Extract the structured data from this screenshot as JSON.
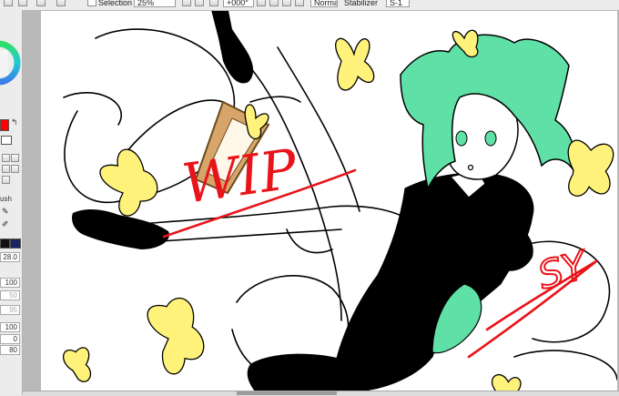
{
  "toolbar": {
    "selection_label": "Selection",
    "zoom_value": "25%",
    "rotation_value": "+000°",
    "blend_mode_value": "Normal",
    "stabilizer_label": "Stabilizer",
    "stabilizer_value": "S-1"
  },
  "left_panel": {
    "brush_label": "ush",
    "brush_size_value": "28.0",
    "rows": [
      "100",
      "50",
      "95",
      "100",
      "0",
      "80"
    ]
  },
  "canvas": {
    "wip_text": "WIP",
    "signature_text": "SY",
    "colors": {
      "hair": "#5fe0a6",
      "butterfly": "#fff27a",
      "annotation": "#e8141a",
      "ink": "#000000"
    }
  }
}
